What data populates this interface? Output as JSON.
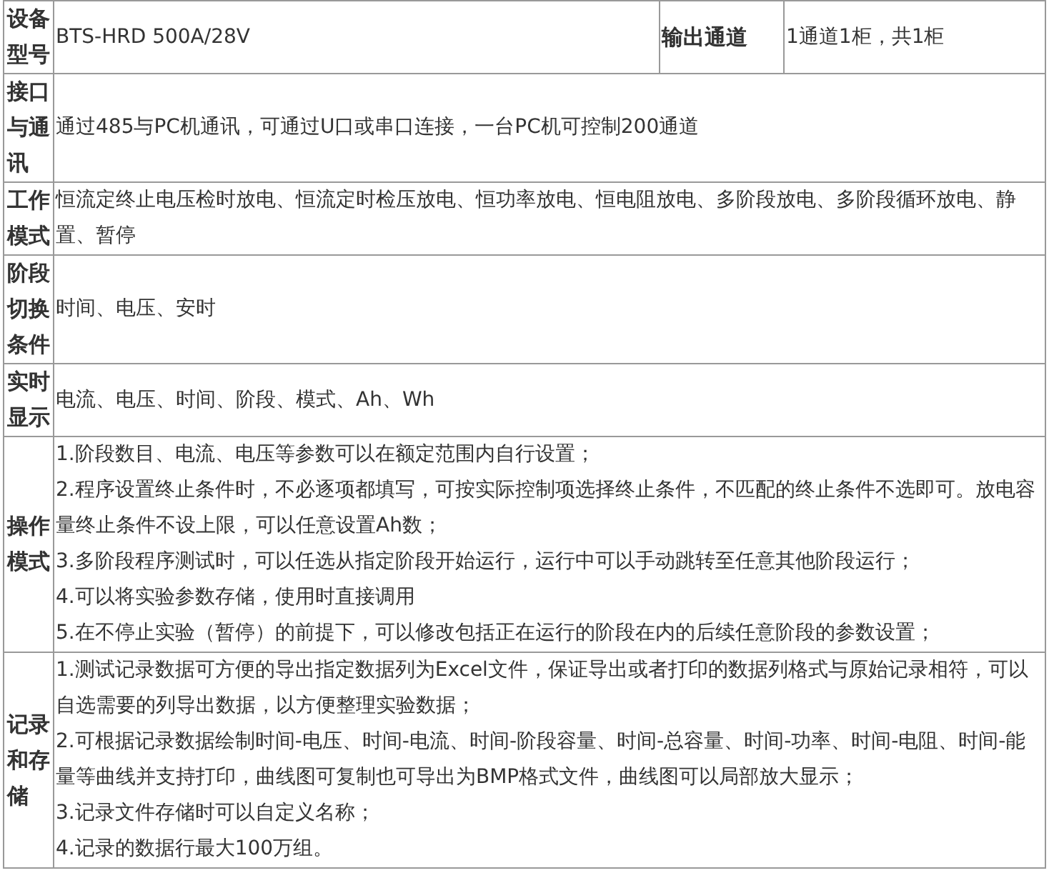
{
  "rows": [
    {
      "label": "设备型号",
      "lines": [
        "BTS-HRD 500A/28V"
      ],
      "extra_label": "输出通道",
      "extra_value": "1通道1柜，共1柜"
    },
    {
      "label": "接口与通讯",
      "lines": [
        "通过485与PC机通讯，可通过U口或串口连接，一台PC机可控制200通道"
      ]
    },
    {
      "label": "工作模式",
      "lines": [
        "恒流定终止电压检时放电、恒流定时检压放电、恒功率放电、恒电阻放电、多阶段放电、多阶段循环放电、静置、暂停"
      ]
    },
    {
      "label": "阶段切换条件",
      "lines": [
        "时间、电压、安时"
      ]
    },
    {
      "label": "实时显示",
      "lines": [
        "电流、电压、时间、阶段、模式、Ah、Wh"
      ]
    },
    {
      "label": "操作模式",
      "lines": [
        "1.阶段数目、电流、电压等参数可以在额定范围内自行设置；",
        "2.程序设置终止条件时，不必逐项都填写，可按实际控制项选择终止条件，不匹配的终止条件不选即可。放电容量终止条件不设上限，可以任意设置Ah数；",
        "3.多阶段程序测试时，可以任选从指定阶段开始运行，运行中可以手动跳转至任意其他阶段运行；",
        "4.可以将实验参数存储，使用时直接调用",
        "5.在不停止实验（暂停）的前提下，可以修改包括正在运行的阶段在内的后续任意阶段的参数设置；"
      ]
    },
    {
      "label": "记录和存储",
      "lines": [
        "1.测试记录数据可方便的导出指定数据列为Excel文件，保证导出或者打印的数据列格式与原始记录相符，可以自选需要的列导出数据，以方便整理实验数据；",
        "2.可根据记录数据绘制时间-电压、时间-电流、时间-阶段容量、时间-总容量、时间-功率、时间-电阻、时间-能量等曲线并支持打印，曲线图可复制也可导出为BMP格式文件，曲线图可以局部放大显示；",
        "3.记录文件存储时可以自定义名称；",
        "4.记录的数据行最大100万组。"
      ]
    }
  ]
}
